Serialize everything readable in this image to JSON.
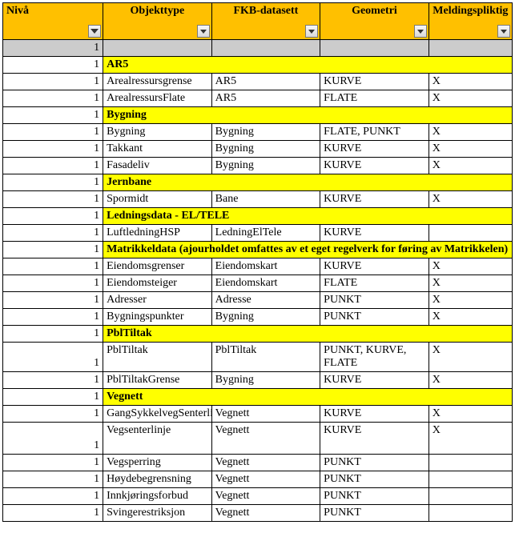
{
  "headers": {
    "nivaa": "Nivå",
    "objekttype": "Objekttype",
    "fkb": "FKB-datasett",
    "geometri": "Geometri",
    "meldingspliktig": "Meldingspliktig"
  },
  "blank_row": {
    "nivaa": "1"
  },
  "sections": [
    {
      "nivaa": "1",
      "title": "AR5",
      "rows": [
        {
          "nivaa": "1",
          "objekttype": "Arealressursgrense",
          "fkb": "AR5",
          "geometri": "KURVE",
          "meld": "X"
        },
        {
          "nivaa": "1",
          "objekttype": "ArealressursFlate",
          "fkb": "AR5",
          "geometri": "FLATE",
          "meld": "X"
        }
      ]
    },
    {
      "nivaa": "1",
      "title": "Bygning",
      "rows": [
        {
          "nivaa": "1",
          "objekttype": "Bygning",
          "fkb": "Bygning",
          "geometri": "FLATE, PUNKT",
          "meld": "X"
        },
        {
          "nivaa": "1",
          "objekttype": "Takkant",
          "fkb": "Bygning",
          "geometri": "KURVE",
          "meld": "X"
        },
        {
          "nivaa": "1",
          "objekttype": "Fasadeliv",
          "fkb": "Bygning",
          "geometri": "KURVE",
          "meld": "X"
        }
      ]
    },
    {
      "nivaa": "1",
      "title": "Jernbane",
      "rows": [
        {
          "nivaa": "1",
          "objekttype": "Spormidt",
          "fkb": "Bane",
          "geometri": "KURVE",
          "meld": "X"
        }
      ]
    },
    {
      "nivaa": "1",
      "title": "Ledningsdata - EL/TELE",
      "rows": [
        {
          "nivaa": "1",
          "objekttype": "LuftledningHSP",
          "fkb": "LedningElTele",
          "geometri": "KURVE",
          "meld": ""
        }
      ]
    },
    {
      "nivaa": "1",
      "title": "Matrikkeldata (ajourholdet omfattes av et eget regelverk for føring av Matrikkelen)",
      "rows": [
        {
          "nivaa": "1",
          "objekttype": "Eiendomsgrenser",
          "fkb": "Eiendomskart",
          "geometri": "KURVE",
          "meld": "X"
        },
        {
          "nivaa": "1",
          "objekttype": "Eiendomsteiger",
          "fkb": "Eiendomskart",
          "geometri": "FLATE",
          "meld": "X"
        },
        {
          "nivaa": "1",
          "objekttype": "Adresser",
          "fkb": "Adresse",
          "geometri": "PUNKT",
          "meld": "X"
        },
        {
          "nivaa": "1",
          "objekttype": "Bygningspunkter",
          "fkb": "Bygning",
          "geometri": "PUNKT",
          "meld": "X"
        }
      ]
    },
    {
      "nivaa": "1",
      "title": "PblTiltak",
      "rows": [
        {
          "nivaa": "1",
          "objekttype": "PblTiltak",
          "fkb": "PblTiltak",
          "geometri": "PUNKT, KURVE, FLATE",
          "meld": "X",
          "wrap": true
        },
        {
          "nivaa": "1",
          "objekttype": "PblTiltakGrense",
          "fkb": "Bygning",
          "geometri": "KURVE",
          "meld": "X"
        }
      ]
    },
    {
      "nivaa": "1",
      "title": "Vegnett",
      "rows": [
        {
          "nivaa": "1",
          "objekttype": "GangSykkelvegSenterlinje",
          "fkb": "Vegnett",
          "geometri": "KURVE",
          "meld": "X"
        },
        {
          "nivaa": "1",
          "objekttype": "Vegsenterlinje",
          "fkb": "Vegnett",
          "geometri": "KURVE",
          "meld": "X",
          "tall": true
        },
        {
          "nivaa": "1",
          "objekttype": "Vegsperring",
          "fkb": "Vegnett",
          "geometri": "PUNKT",
          "meld": ""
        },
        {
          "nivaa": "1",
          "objekttype": "Høydebegrensning",
          "fkb": "Vegnett",
          "geometri": "PUNKT",
          "meld": ""
        },
        {
          "nivaa": "1",
          "objekttype": "Innkjøringsforbud",
          "fkb": "Vegnett",
          "geometri": "PUNKT",
          "meld": ""
        },
        {
          "nivaa": "1",
          "objekttype": "Svingerestriksjon",
          "fkb": "Vegnett",
          "geometri": "PUNKT",
          "meld": ""
        }
      ]
    }
  ]
}
